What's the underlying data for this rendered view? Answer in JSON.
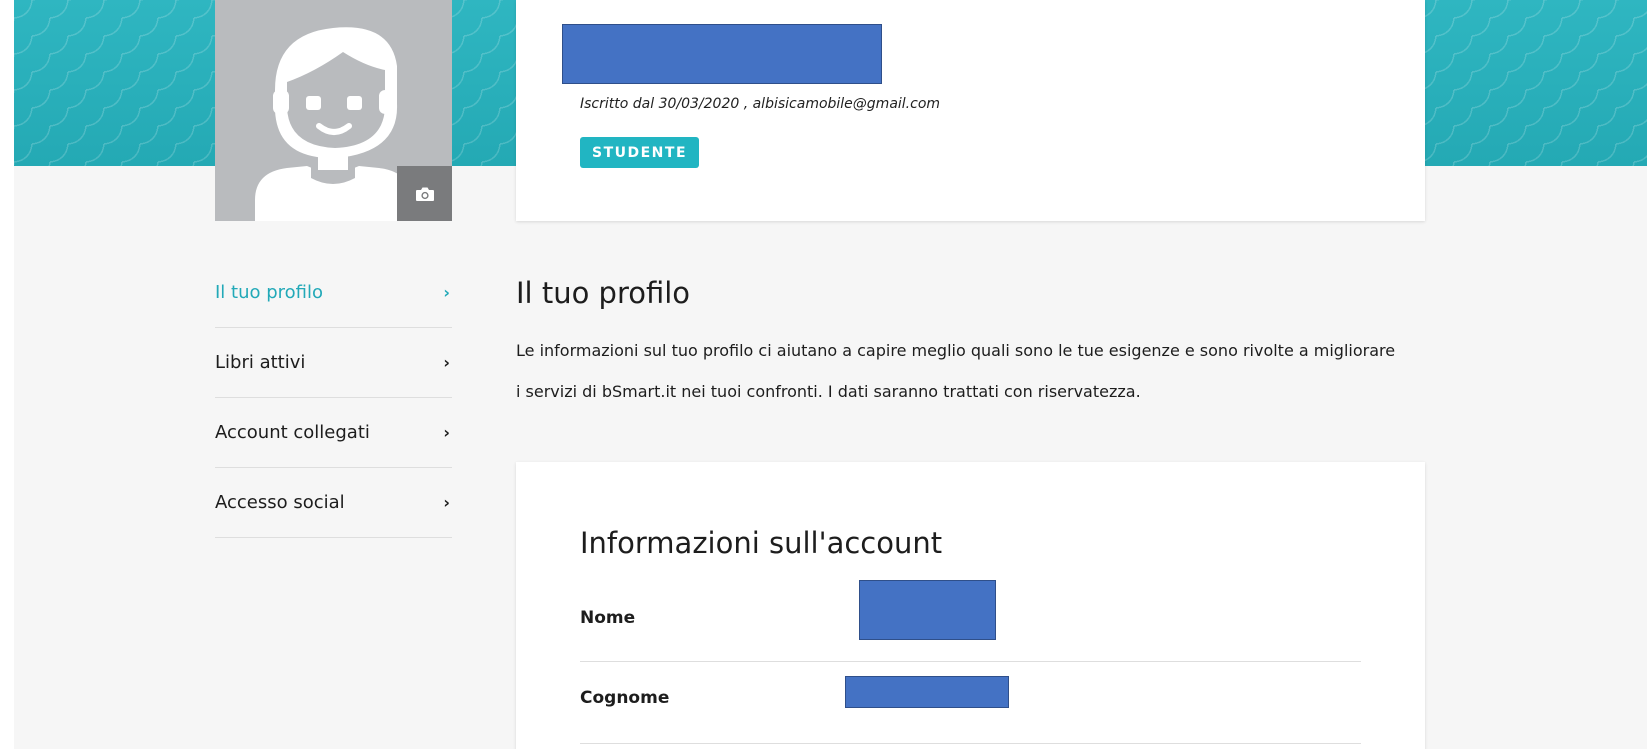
{
  "header": {
    "member_info": "Iscritto dal 30/03/2020 , albisicamobile@gmail.com",
    "role_badge": "STUDENTE"
  },
  "icons": {
    "avatar": "user-avatar-icon",
    "camera": "camera-icon",
    "chevron": "chevron-right-icon"
  },
  "sidebar": {
    "items": [
      {
        "label": "Il tuo profilo",
        "chevron": "›",
        "active": true
      },
      {
        "label": "Libri attivi",
        "chevron": "›",
        "active": false
      },
      {
        "label": "Account collegati",
        "chevron": "›",
        "active": false
      },
      {
        "label": "Accesso social",
        "chevron": "›",
        "active": false
      }
    ]
  },
  "main": {
    "title": "Il tuo profilo",
    "description": "Le informazioni sul tuo profilo ci aiutano a capire meglio quali sono le tue esigenze e sono rivolte a migliorare i servizi di bSmart.it nei tuoi confronti. I dati saranno trattati con riservatezza."
  },
  "account": {
    "title": "Informazioni sull'account",
    "fields": [
      {
        "label": "Nome",
        "value": ""
      },
      {
        "label": "Cognome",
        "value": ""
      }
    ]
  },
  "colors": {
    "accent": "#22a9b8",
    "banner": "#2bb1bc",
    "badge": "#21b5c2",
    "redaction": "#4472c4"
  }
}
